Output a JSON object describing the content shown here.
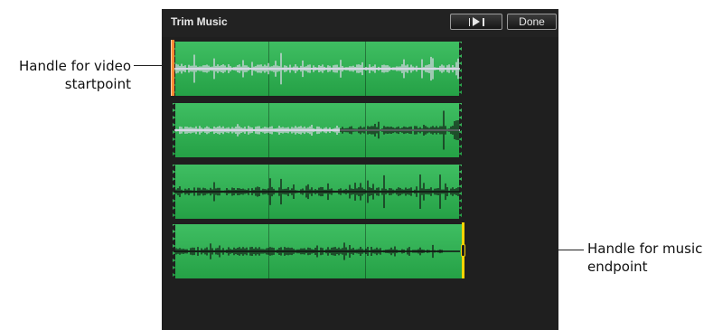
{
  "window": {
    "title": "Trim Music",
    "play_button_icon": "play-selection-icon",
    "done_label": "Done"
  },
  "callouts": {
    "video_start": "Handle for video startpoint",
    "music_end": "Handle for music endpoint"
  },
  "tracks": [
    {
      "row": 1,
      "wave_color": "#e8dcf4"
    },
    {
      "row": 2,
      "wave_color": "#e8dcf4",
      "dark_tail": true
    },
    {
      "row": 3,
      "wave_color": "#111111"
    },
    {
      "row": 4,
      "wave_color": "#111111"
    }
  ],
  "colors": {
    "track_green": "#2fae51",
    "start_handle": "#ff8a33",
    "end_handle": "#ffd400",
    "window_bg": "#1f1f1f"
  }
}
